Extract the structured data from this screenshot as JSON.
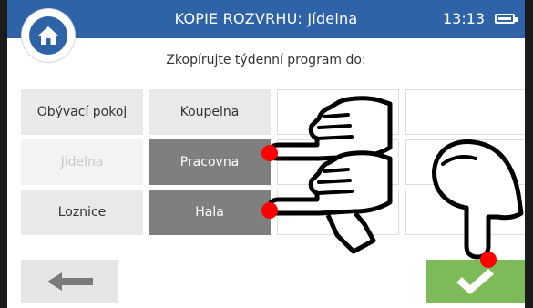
{
  "header": {
    "title": "KOPIE ROZVRHU: Jídelna",
    "time": "13:13",
    "battery_icon": "battery-full-icon",
    "home_icon": "home-icon"
  },
  "subtitle": "Zkopírujte týdenní program do:",
  "rooms": [
    {
      "label": "Obývací pokoj",
      "state": "normal"
    },
    {
      "label": "Koupelna",
      "state": "normal"
    },
    {
      "label": "",
      "state": "empty"
    },
    {
      "label": "",
      "state": "empty"
    },
    {
      "label": "Jídelna",
      "state": "disabled"
    },
    {
      "label": "Pracovna",
      "state": "selected"
    },
    {
      "label": "",
      "state": "empty"
    },
    {
      "label": "",
      "state": "empty"
    },
    {
      "label": "Loznice",
      "state": "normal"
    },
    {
      "label": "Hala",
      "state": "selected"
    },
    {
      "label": "",
      "state": "empty"
    },
    {
      "label": "",
      "state": "empty"
    }
  ],
  "footer": {
    "back_icon": "arrow-left-icon",
    "confirm_icon": "checkmark-icon"
  },
  "colors": {
    "titlebar": "#2f63a8",
    "selected_cell": "#7f7f7f",
    "confirm_button": "#7dbb58",
    "touch_dot": "#ff0000"
  }
}
